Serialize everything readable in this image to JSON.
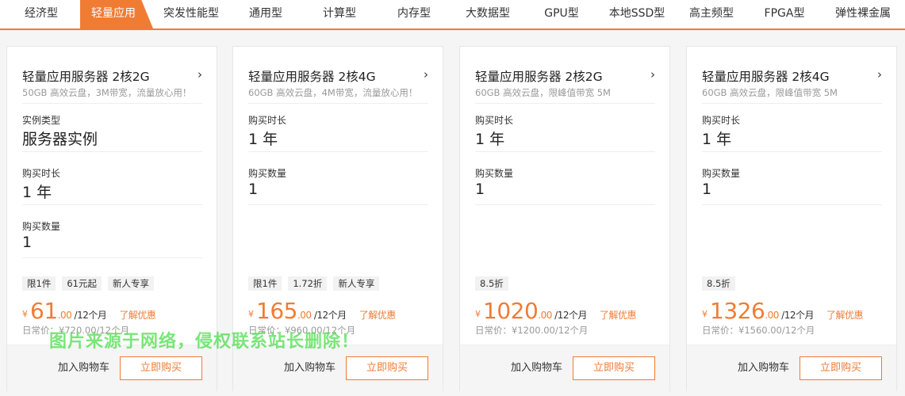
{
  "tabs": [
    "经济型",
    "轻量应用",
    "突发性能型",
    "通用型",
    "计算型",
    "内存型",
    "大数据型",
    "GPU型",
    "本地SSD型",
    "高主频型",
    "FPGA型",
    "弹性裸金属"
  ],
  "active_tab": "轻量应用",
  "colors": {
    "accent": "#f07c34",
    "watermark": "#46dc46"
  },
  "cards": [
    {
      "title": "轻量应用服务器 2核2G",
      "desc": "50GB 高效云盘，3M带宽，流量放心用！",
      "fields": [
        {
          "label": "实例类型",
          "value": "服务器实例"
        },
        {
          "label": "购买时长",
          "value": "1 年"
        },
        {
          "label": "购买数量",
          "value": "1"
        }
      ],
      "tags": [
        "限1件",
        "61元起",
        "新人专享"
      ],
      "price_yen": "¥",
      "price_int": "61",
      "price_dec": ".00",
      "price_per": " /12个月",
      "promo": "了解优惠",
      "original_price": "日常价：¥720.00/12个月",
      "add_to_cart": "加入购物车",
      "buy_now": "立即购买"
    },
    {
      "title": "轻量应用服务器 2核4G",
      "desc": "60GB 高效云盘，4M带宽，流量放心用！",
      "fields": [
        {
          "label": "购买时长",
          "value": "1 年"
        },
        {
          "label": "购买数量",
          "value": "1"
        }
      ],
      "tags": [
        "限1件",
        "1.72折",
        "新人专享"
      ],
      "price_yen": "¥",
      "price_int": "165",
      "price_dec": ".00",
      "price_per": " /12个月",
      "promo": "了解优惠",
      "original_price": "日常价：¥960.00/12个月",
      "add_to_cart": "加入购物车",
      "buy_now": "立即购买"
    },
    {
      "title": "轻量应用服务器 2核2G",
      "desc": "60GB 高效云盘，限峰值带宽 5M",
      "fields": [
        {
          "label": "购买时长",
          "value": "1 年"
        },
        {
          "label": "购买数量",
          "value": "1"
        }
      ],
      "tags": [
        "8.5折"
      ],
      "price_yen": "¥",
      "price_int": "1020",
      "price_dec": ".00",
      "price_per": " /12个月",
      "promo": "了解优惠",
      "original_price": "日常价：¥1200.00/12个月",
      "add_to_cart": "加入购物车",
      "buy_now": "立即购买"
    },
    {
      "title": "轻量应用服务器 2核4G",
      "desc": "60GB 高效云盘，限峰值带宽 5M",
      "fields": [
        {
          "label": "购买时长",
          "value": "1 年"
        },
        {
          "label": "购买数量",
          "value": "1"
        }
      ],
      "tags": [
        "8.5折"
      ],
      "price_yen": "¥",
      "price_int": "1326",
      "price_dec": ".00",
      "price_per": " /12个月",
      "promo": "了解优惠",
      "original_price": "日常价：¥1560.00/12个月",
      "add_to_cart": "加入购物车",
      "buy_now": "立即购买"
    }
  ],
  "icons": {
    "card_chevron": "chevron-right-icon"
  },
  "watermark": "图片来源于网络，侵权联系站长删除！"
}
